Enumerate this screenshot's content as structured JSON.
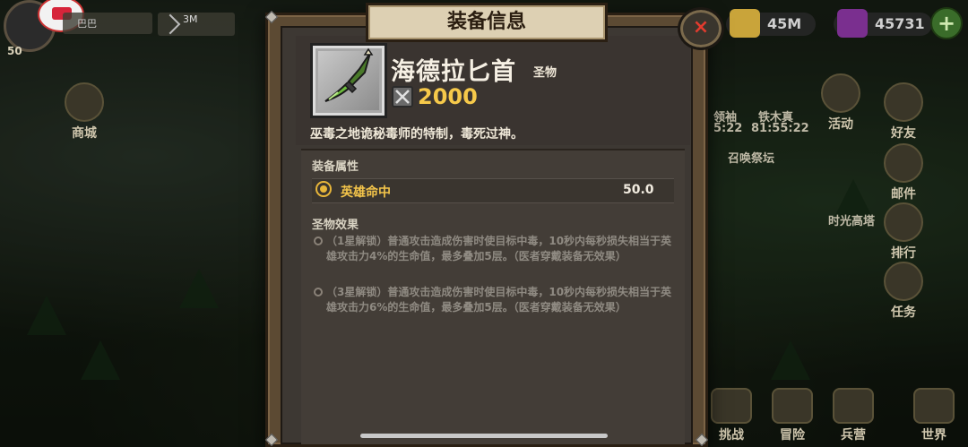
{
  "hud": {
    "level": "50",
    "player_name": "巴巴",
    "power": "3M",
    "gold": "45M",
    "gems": "45731",
    "plus_label": "+"
  },
  "side_left": [
    {
      "label": "商城",
      "icon": "shop-icon"
    }
  ],
  "side_right": [
    {
      "label": "活动",
      "icon": "event-icon"
    },
    {
      "label": "好友",
      "icon": "friends-icon"
    },
    {
      "label": "邮件",
      "icon": "mail-icon"
    },
    {
      "label": "排行",
      "icon": "rank-icon"
    },
    {
      "label": "任务",
      "icon": "quest-icon"
    }
  ],
  "map_labels": {
    "leader_a": "领袖",
    "leader_b": "铁木真",
    "timer_a": "5:22",
    "timer_b": "81:55:22",
    "summon_altar": "召唤祭坛",
    "time_tower": "时光高塔"
  },
  "bottom_bar": [
    {
      "label": "挑战",
      "icon": "swords-icon"
    },
    {
      "label": "冒险",
      "icon": "adventure-icon"
    },
    {
      "label": "兵营",
      "icon": "barracks-icon"
    },
    {
      "label": "世界",
      "icon": "world-map-icon"
    }
  ],
  "dialog": {
    "title": "装备信息",
    "close_label": "×",
    "item": {
      "name": "海德拉匕首",
      "type": "圣物",
      "power": "2000",
      "description": "巫毒之地诡秘毒师的特制，毒死过神。"
    },
    "attributes_title": "装备属性",
    "attributes": [
      {
        "name": "英雄命中",
        "value": "50.0"
      }
    ],
    "effects_title": "圣物效果",
    "effects": [
      {
        "text": "（1星解锁）普通攻击造成伤害时使目标中毒，10秒内每秒损失相当于英雄攻击力4%的生命值，最多叠加5层。（医者穿戴装备无效果）"
      },
      {
        "text": "（3星解锁）普通攻击造成伤害时使目标中毒，10秒内每秒损失相当于英雄攻击力6%的生命值，最多叠加5层。（医者穿戴装备无效果）"
      }
    ]
  },
  "colors": {
    "title_banner": "#ddd0b3",
    "power_value": "#f6c94a",
    "attribute_name": "#f3c44a",
    "close_x": "#e23b2e"
  }
}
